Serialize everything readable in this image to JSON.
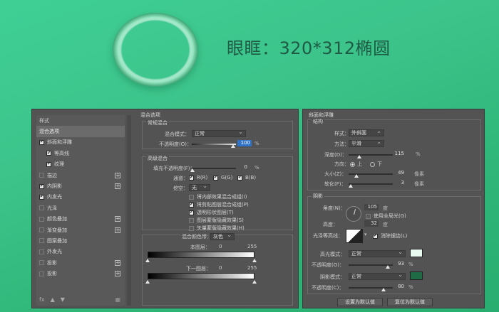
{
  "headline": "眼眶：320*312椭圆",
  "styles_panel": {
    "header": "样式",
    "items": [
      {
        "label": "混合选项",
        "checked": null,
        "plus": false,
        "active": true,
        "indent": false
      },
      {
        "label": "斜面和浮雕",
        "checked": true,
        "plus": false,
        "active": false,
        "indent": false
      },
      {
        "label": "等高线",
        "checked": true,
        "plus": false,
        "active": false,
        "indent": true
      },
      {
        "label": "纹理",
        "checked": true,
        "plus": false,
        "active": false,
        "indent": true
      },
      {
        "label": "描边",
        "checked": false,
        "plus": true,
        "active": false,
        "indent": false
      },
      {
        "label": "内阴影",
        "checked": true,
        "plus": true,
        "active": false,
        "indent": false
      },
      {
        "label": "内发光",
        "checked": true,
        "plus": false,
        "active": false,
        "indent": false
      },
      {
        "label": "光泽",
        "checked": false,
        "plus": false,
        "active": false,
        "indent": false
      },
      {
        "label": "颜色叠加",
        "checked": false,
        "plus": true,
        "active": false,
        "indent": false
      },
      {
        "label": "渐变叠加",
        "checked": false,
        "plus": true,
        "active": false,
        "indent": false
      },
      {
        "label": "图案叠加",
        "checked": false,
        "plus": false,
        "active": false,
        "indent": false
      },
      {
        "label": "外发光",
        "checked": false,
        "plus": false,
        "active": false,
        "indent": false
      },
      {
        "label": "投影",
        "checked": false,
        "plus": true,
        "active": false,
        "indent": false
      },
      {
        "label": "投影",
        "checked": false,
        "plus": true,
        "active": false,
        "indent": false
      }
    ],
    "footer_fx": "fx"
  },
  "blend_options": {
    "title": "混合选项",
    "general": {
      "title": "常规混合",
      "mode_label": "混合模式：",
      "mode_value": "正常",
      "opacity_label": "不透明度(O)：",
      "opacity_value": "100",
      "opacity_unit": "%"
    },
    "advanced": {
      "title": "高级混合",
      "fill_label": "填充不透明度(F)：",
      "fill_value": "0",
      "fill_unit": "%",
      "channels_label": "通道：",
      "channels": [
        "R(R)",
        "G(G)",
        "B(B)"
      ],
      "knockout_label": "挖空：",
      "knockout_value": "无",
      "options": [
        {
          "label": "将内部效果混合成组(I)",
          "checked": false
        },
        {
          "label": "将剪贴图层混合成组(P)",
          "checked": true
        },
        {
          "label": "透明形状图层(T)",
          "checked": true
        },
        {
          "label": "图层蒙版隐藏效果(S)",
          "checked": false
        },
        {
          "label": "矢量蒙版隐藏效果(H)",
          "checked": false
        }
      ]
    },
    "blend_if": {
      "label": "混合颜色带：",
      "value": "灰色",
      "this_layer": "本图层：",
      "underlying": "下一图层：",
      "min": "0",
      "max": "255"
    }
  },
  "bevel": {
    "title": "斜面和浮雕",
    "structure": {
      "title": "结构",
      "style_label": "样式：",
      "style_value": "外斜面",
      "technique_label": "方法：",
      "technique_value": "平滑",
      "depth_label": "深度(D)：",
      "depth_value": "115",
      "depth_unit": "%",
      "direction_label": "方向：",
      "up_label": "上",
      "down_label": "下",
      "size_label": "大小(Z)：",
      "size_value": "49",
      "size_unit": "像素",
      "soften_label": "软化(F)：",
      "soften_value": "3",
      "soften_unit": "像素"
    },
    "shading": {
      "title": "阴影",
      "angle_label": "角度(N)：",
      "angle_value": "105",
      "angle_unit": "度",
      "global_light_label": "使用全局光(G)",
      "altitude_label": "高度：",
      "altitude_value": "32",
      "altitude_unit": "度",
      "gloss_label": "光泽等高线：",
      "antialias_label": "消除锯齿(L)",
      "highlight_mode_label": "高光模式：",
      "highlight_mode_value": "正常",
      "highlight_color": "#e9fbf1",
      "highlight_opacity_label": "不透明度(O)：",
      "highlight_opacity_value": "93",
      "highlight_opacity_unit": "%",
      "shadow_mode_label": "阴影模式：",
      "shadow_mode_value": "正常",
      "shadow_color": "#1f6b45",
      "shadow_opacity_label": "不透明度(C)：",
      "shadow_opacity_value": "80",
      "shadow_opacity_unit": "%"
    },
    "buttons": {
      "make_default": "设置为默认值",
      "reset_default": "复位为默认值"
    }
  }
}
